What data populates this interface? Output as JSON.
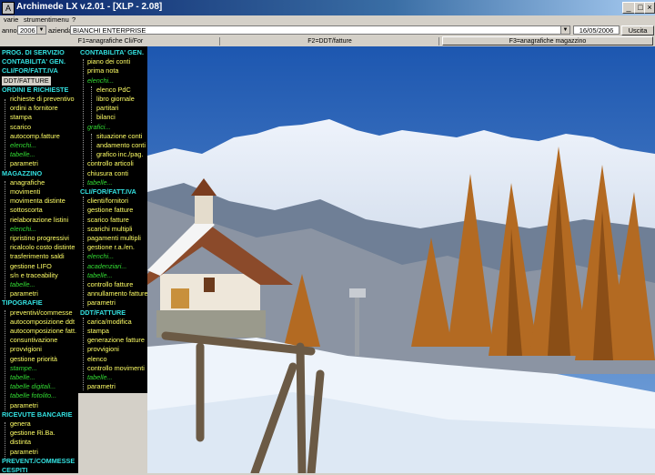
{
  "window": {
    "title": "Archimede LX v.2.01 - [XLP - 2.08]",
    "buttons": [
      "_",
      "□",
      "×"
    ]
  },
  "menu": [
    "varie",
    "strumenti",
    "menu",
    "?"
  ],
  "filter": {
    "year_label": "anno",
    "year_value": "2006",
    "company_label": "azienda",
    "company_value": "BIANCHI ENTERPRISE",
    "date": "16/05/2006",
    "exit_label": "Uscita"
  },
  "function_keys": [
    "F1=anagrafiche Cli/For",
    "F2=DDT/fatture",
    "F3=anagrafiche magazzino"
  ],
  "left_menu": [
    {
      "text": "PROG. DI SERVIZIO",
      "kind": "hdr"
    },
    {
      "text": "CONTABILITA' GEN.",
      "kind": "hdr"
    },
    {
      "text": "CLI/FOR/FATT.IVA",
      "kind": "hdr"
    },
    {
      "text": "DDT/FATTURE",
      "kind": "active"
    },
    {
      "text": "ORDINI E RICHIESTE",
      "kind": "hdr"
    },
    {
      "text": "richieste di preventivo",
      "kind": "item"
    },
    {
      "text": "ordini a fornitore",
      "kind": "item"
    },
    {
      "text": "stampa",
      "kind": "item"
    },
    {
      "text": "scarico",
      "kind": "item"
    },
    {
      "text": "autocomp.fatture",
      "kind": "item"
    },
    {
      "text": "elenchi...",
      "kind": "sub"
    },
    {
      "text": "tabelle...",
      "kind": "sub"
    },
    {
      "text": "parametri",
      "kind": "item"
    },
    {
      "text": "MAGAZZINO",
      "kind": "hdr"
    },
    {
      "text": "anagrafiche",
      "kind": "item"
    },
    {
      "text": "movimenti",
      "kind": "item"
    },
    {
      "text": "movimenta distinte",
      "kind": "item"
    },
    {
      "text": "sottoscorta",
      "kind": "item"
    },
    {
      "text": "rielaborazione listini",
      "kind": "item"
    },
    {
      "text": "elenchi...",
      "kind": "sub"
    },
    {
      "text": "ripristino progressivi",
      "kind": "item"
    },
    {
      "text": "ricalcolo costo distinte",
      "kind": "item"
    },
    {
      "text": "trasferimento saldi",
      "kind": "item"
    },
    {
      "text": "gestione LIFO",
      "kind": "item"
    },
    {
      "text": "s/n e traceability",
      "kind": "item"
    },
    {
      "text": "tabelle...",
      "kind": "sub"
    },
    {
      "text": "parametri",
      "kind": "item"
    },
    {
      "text": "TIPOGRAFIE",
      "kind": "hdr"
    },
    {
      "text": "preventivi/commesse",
      "kind": "item"
    },
    {
      "text": "autocomposizione ddt",
      "kind": "item"
    },
    {
      "text": "autocomposizione fatt.",
      "kind": "item"
    },
    {
      "text": "consuntivazione",
      "kind": "item"
    },
    {
      "text": "provvigioni",
      "kind": "item"
    },
    {
      "text": "gestione priorità",
      "kind": "item"
    },
    {
      "text": "stampe...",
      "kind": "sub"
    },
    {
      "text": "tabelle...",
      "kind": "sub"
    },
    {
      "text": "tabelle digitali...",
      "kind": "sub"
    },
    {
      "text": "tabelle fotolito...",
      "kind": "sub"
    },
    {
      "text": "parametri",
      "kind": "item"
    },
    {
      "text": "RICEVUTE BANCARIE",
      "kind": "hdr"
    },
    {
      "text": "genera",
      "kind": "item"
    },
    {
      "text": "gestione Ri.Ba.",
      "kind": "item"
    },
    {
      "text": "distinta",
      "kind": "item"
    },
    {
      "text": "parametri",
      "kind": "item"
    },
    {
      "text": "PREVENT./COMMESSE",
      "kind": "hdr"
    },
    {
      "text": "CESPITI",
      "kind": "hdr"
    }
  ],
  "mid_menu": [
    {
      "text": "CONTABILITA' GEN.",
      "kind": "hdr"
    },
    {
      "text": "piano dei conti",
      "kind": "item"
    },
    {
      "text": "prima nota",
      "kind": "item"
    },
    {
      "text": "elenchi...",
      "kind": "sub"
    },
    {
      "text": "elenco PdC",
      "kind": "item"
    },
    {
      "text": "libro giornale",
      "kind": "item"
    },
    {
      "text": "partitari",
      "kind": "item"
    },
    {
      "text": "bilanci",
      "kind": "item"
    },
    {
      "text": "grafici...",
      "kind": "sub"
    },
    {
      "text": "situazione conti",
      "kind": "item"
    },
    {
      "text": "andamento conti",
      "kind": "item"
    },
    {
      "text": "grafico inc./pag.",
      "kind": "item"
    },
    {
      "text": "controllo articoli",
      "kind": "item"
    },
    {
      "text": "chiusura conti",
      "kind": "item"
    },
    {
      "text": "tabelle...",
      "kind": "sub"
    },
    {
      "text": "CLI/FOR/FATT.IVA",
      "kind": "hdr"
    },
    {
      "text": "clienti/fornitori",
      "kind": "item"
    },
    {
      "text": "gestione fatture",
      "kind": "item"
    },
    {
      "text": "scarico fatture",
      "kind": "item"
    },
    {
      "text": "scarichi multipli",
      "kind": "item"
    },
    {
      "text": "pagamenti multipli",
      "kind": "item"
    },
    {
      "text": "gestione r.a./en.",
      "kind": "item"
    },
    {
      "text": "elenchi...",
      "kind": "sub"
    },
    {
      "text": "acadenziari...",
      "kind": "sub"
    },
    {
      "text": "tabelle...",
      "kind": "sub"
    },
    {
      "text": "controllo fatture",
      "kind": "item"
    },
    {
      "text": "annullamento fatture",
      "kind": "item"
    },
    {
      "text": "parametri",
      "kind": "item"
    },
    {
      "text": "DDT/FATTURE",
      "kind": "hdr"
    },
    {
      "text": "carica/modifica",
      "kind": "item"
    },
    {
      "text": "stampa",
      "kind": "item"
    },
    {
      "text": "generazione fatture",
      "kind": "item"
    },
    {
      "text": "provvigioni",
      "kind": "item"
    },
    {
      "text": "elenco",
      "kind": "item"
    },
    {
      "text": "controllo movimenti",
      "kind": "item"
    },
    {
      "text": "tabelle...",
      "kind": "sub"
    },
    {
      "text": "parametri",
      "kind": "item"
    }
  ]
}
